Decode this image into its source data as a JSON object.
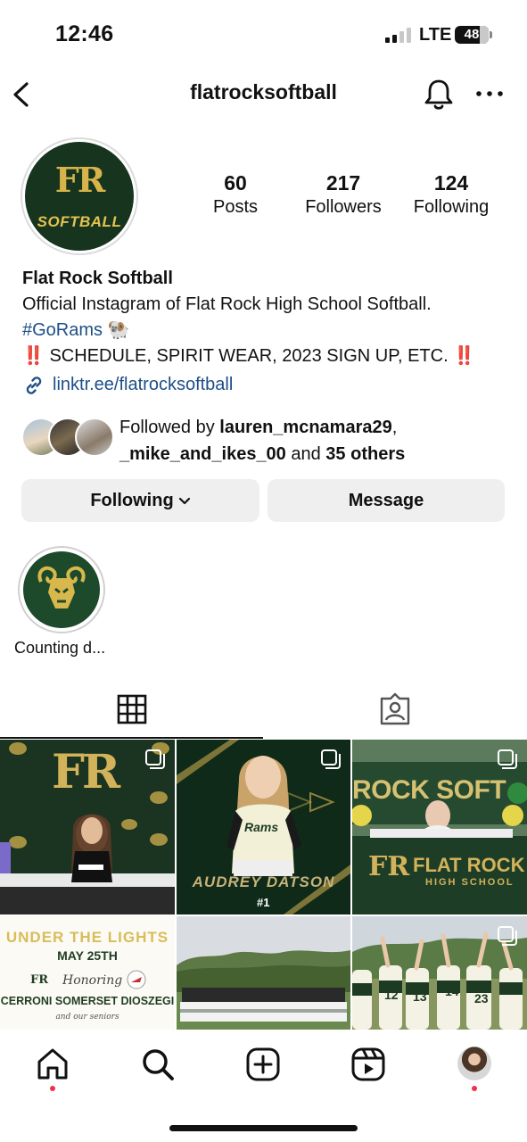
{
  "status": {
    "time": "12:46",
    "network": "LTE",
    "battery": "48"
  },
  "header": {
    "username": "flatrocksoftball"
  },
  "avatar": {
    "line1": "FR",
    "line2": "SOFTBALL"
  },
  "stats": {
    "posts_num": "60",
    "posts_label": "Posts",
    "followers_num": "217",
    "followers_label": "Followers",
    "following_num": "124",
    "following_label": "Following"
  },
  "bio": {
    "name": "Flat Rock Softball",
    "line1": "Official Instagram of Flat Rock High School Softball.",
    "hashtag": "#GoRams",
    "emoji": "🐏",
    "bang_left": "‼️",
    "line3": "SCHEDULE, SPIRIT WEAR, 2023 SIGN UP, ETC.",
    "bang_right": "‼️",
    "link": "linktr.ee/flatrocksoftball"
  },
  "followed_by": {
    "prefix": "Followed by ",
    "user1": "lauren_mcnamara29",
    "comma": ",",
    "user2": "_mike_and_ikes_00",
    "and": " and ",
    "others": "35 others"
  },
  "buttons": {
    "following": "Following",
    "message": "Message"
  },
  "highlights": [
    {
      "label": "Counting d..."
    }
  ],
  "grid_posts": [
    {
      "caption": "FR"
    },
    {
      "caption": "AUDREY DATSON",
      "number": "#1",
      "jersey": "Rams"
    },
    {
      "banner": "ROCK SOFT",
      "sign": "FLAT ROCK",
      "sign_sub": "HIGH SCHOOL",
      "sign_fr": "FR"
    },
    {
      "title": "UNDER THE LIGHTS",
      "date": "MAY 25TH",
      "honoring": "Honoring",
      "names": "CERRONI SOMERSET DIOSZEGI",
      "footer": "and our seniors",
      "fr": "FR"
    },
    {},
    {
      "jerseys": [
        "12",
        "13",
        "14",
        "23"
      ]
    }
  ],
  "colors": {
    "brand_green": "#17341f",
    "gold": "#d6b44a",
    "link": "#1e4f86",
    "alert": "#d62d2d",
    "notif_dot": "#f0304a"
  }
}
